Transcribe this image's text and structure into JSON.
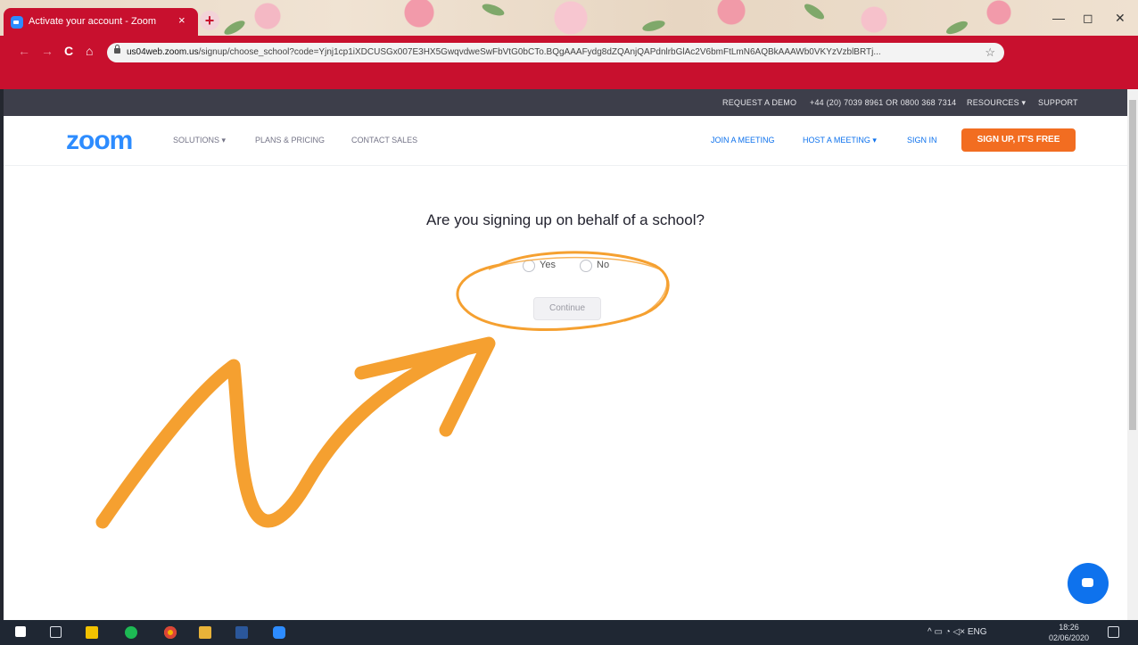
{
  "browser": {
    "tab_title": "Activate your account - Zoom",
    "tab_close": "×",
    "new_tab": "+",
    "minimize": "—",
    "maximize": "◻",
    "close": "✕",
    "url_host": "us04web.zoom.us",
    "url_path": "/signup/choose_school?code=Yjnj1cp1iXDCUSGx007E3HX5GwqvdweSwFbVtG0bCTo.BQgAAAFydg8dZQAnjQAPdnlrbGlAc2V6bmFtLmN6AQBkAAAWb0VKYzVzblBRTj...",
    "back": "←",
    "forward": "→",
    "reload": "C",
    "home": "⌂",
    "bookmark_star": "☆"
  },
  "top_strip": {
    "request_demo": "REQUEST A DEMO",
    "phone": "+44 (20) 7039 8961 OR 0800 368 7314",
    "resources": "RESOURCES ▾",
    "support": "SUPPORT"
  },
  "nav": {
    "logo": "zoom",
    "solutions": "SOLUTIONS ▾",
    "plans": "PLANS & PRICING",
    "contact": "CONTACT SALES",
    "join": "JOIN A MEETING",
    "host": "HOST A MEETING ▾",
    "signin": "SIGN IN",
    "signup": "SIGN UP, IT'S FREE"
  },
  "form": {
    "question": "Are you signing up on behalf of a school?",
    "yes": "Yes",
    "no": "No",
    "continue": "Continue"
  },
  "taskbar": {
    "tray": "^  ▭  ◔  ◁×  ENG",
    "time": "18:26",
    "date": "02/06/2020"
  },
  "colors": {
    "zoom_blue": "#2d8cff",
    "signup_orange": "#f26d21",
    "annotation_orange": "#f5a030",
    "browser_red": "#c8102e"
  }
}
